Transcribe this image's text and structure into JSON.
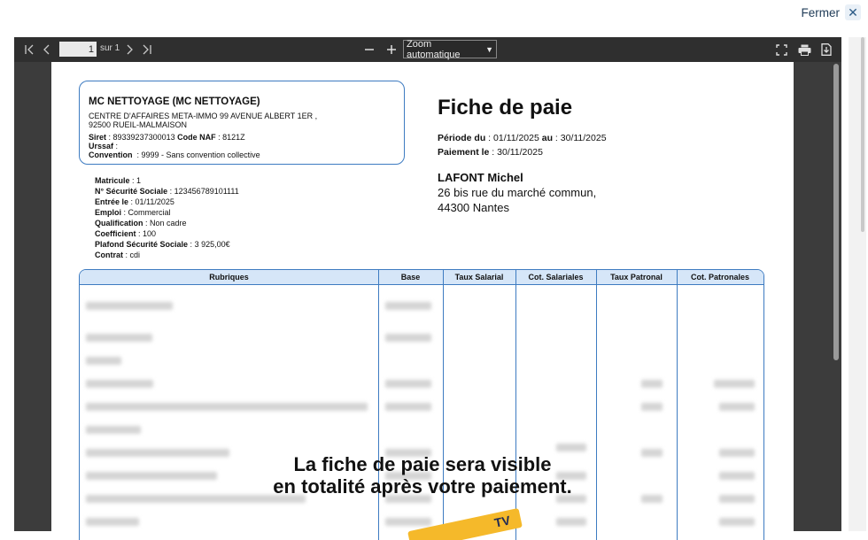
{
  "close": {
    "label": "Fermer"
  },
  "toolbar": {
    "page_current": "1",
    "page_of": "sur 1",
    "zoom": "Zoom automatique"
  },
  "document": {
    "company": {
      "name": "MC NETTOYAGE (MC NETTOYAGE)",
      "address_line1": "CENTRE D'AFFAIRES META-IMMO 99 AVENUE ALBERT 1ER ,",
      "address_line2": "92500 RUEIL-MALMAISON",
      "siret_label": "Siret",
      "siret": "89339237300013",
      "naf_label": "Code NAF",
      "naf": "8121Z",
      "urssaf_label": "Urssaf",
      "convention_label": "Convention",
      "convention": "9999 - Sans convention collective"
    },
    "title": "Fiche de paie",
    "period_label": "Période du",
    "period_from": "01/11/2025",
    "period_to_label": "au",
    "period_to": "30/11/2025",
    "payment_label": "Paiement le",
    "payment_date": "30/11/2025",
    "employee": {
      "name": "LAFONT Michel",
      "address_line1": "26 bis rue du marché commun,",
      "address_line2": "44300 Nantes"
    },
    "details": [
      {
        "label": "Matricule",
        "value": "1"
      },
      {
        "label": "N° Sécurité Sociale",
        "value": "123456789101111"
      },
      {
        "label": "Entrée le",
        "value": "01/11/2025"
      },
      {
        "label": "Emploi",
        "value": "Commercial"
      },
      {
        "label": "Qualification",
        "value": "Non cadre"
      },
      {
        "label": "Coefficient",
        "value": "100"
      },
      {
        "label": "Plafond Sécurité Sociale",
        "value": "3 925,00€"
      },
      {
        "label": "Contrat",
        "value": "cdi"
      }
    ],
    "table_headers": [
      "Rubriques",
      "Base",
      "Taux Salarial",
      "Cot. Salariales",
      "Taux Patronal",
      "Cot. Patronales"
    ],
    "overlay_line1": "La fiche de paie sera visible",
    "overlay_line2": "en totalité après votre paiement.",
    "badge_text": "TV"
  },
  "icons": {
    "first": "first-page-icon",
    "prev": "previous-page-icon",
    "next": "next-page-icon",
    "last": "last-page-icon",
    "zoom_out": "minus-icon",
    "zoom_in": "plus-icon",
    "fullscreen": "fullscreen-icon",
    "print": "print-icon",
    "download": "download-icon",
    "close": "close-icon"
  }
}
